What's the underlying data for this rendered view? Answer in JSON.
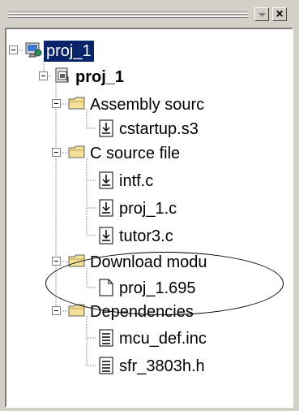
{
  "titlebar": {
    "dropdown_icon": "chevron-down-icon",
    "close_icon": "close-icon",
    "close_glyph": "×"
  },
  "tree": {
    "root": {
      "label": "proj_1",
      "selected": true,
      "icon": "workspace-icon"
    },
    "project": {
      "label": "proj_1",
      "icon": "project-icon"
    },
    "groups": [
      {
        "label": "Assembly sourc",
        "icon": "folder-icon",
        "files": [
          {
            "label": "cstartup.s3",
            "icon": "source-file-icon"
          }
        ]
      },
      {
        "label": "C source file",
        "icon": "folder-icon",
        "files": [
          {
            "label": "intf.c",
            "icon": "source-file-icon"
          },
          {
            "label": "proj_1.c",
            "icon": "source-file-icon"
          },
          {
            "label": "tutor3.c",
            "icon": "source-file-icon"
          }
        ]
      },
      {
        "label": "Download modu",
        "icon": "folder-icon",
        "files": [
          {
            "label": "proj_1.695",
            "icon": "blank-file-icon"
          }
        ]
      },
      {
        "label": "Dependencies",
        "icon": "folder-icon",
        "files": [
          {
            "label": "mcu_def.inc",
            "icon": "text-file-icon"
          },
          {
            "label": "sfr_3803h.h",
            "icon": "text-file-icon"
          }
        ]
      }
    ]
  },
  "colors": {
    "selection_bg": "#0a246a",
    "folder_yellow": "#f4e29a",
    "panel_bg": "#d4d0c8"
  }
}
